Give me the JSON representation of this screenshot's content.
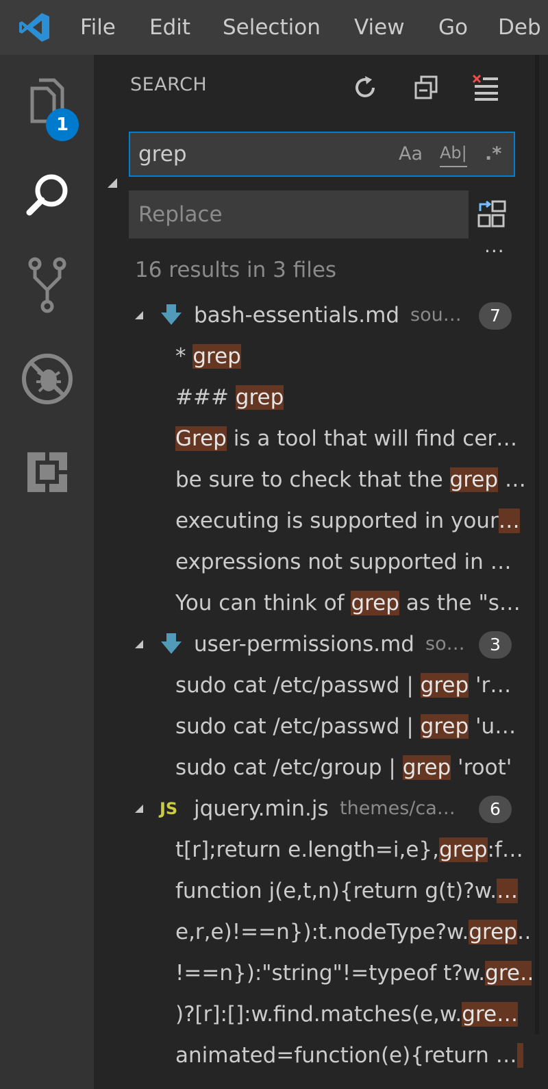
{
  "menu": [
    "File",
    "Edit",
    "Selection",
    "View",
    "Go",
    "Deb"
  ],
  "activity": {
    "explorer_badge": "1",
    "items": [
      "explorer-icon",
      "search-icon",
      "source-control-icon",
      "debug-icon",
      "extensions-icon"
    ]
  },
  "colors": {
    "accent": "#007acc",
    "match_highlight": "#653723",
    "clear_icon": "#f14c4c",
    "markdown_icon": "#519aba",
    "js_icon": "#cbcb41"
  },
  "search": {
    "title": "SEARCH",
    "query": "grep",
    "match_case_label": "Aa",
    "whole_word_label": "Ab|",
    "regex_label": ".*",
    "replace_placeholder": "Replace",
    "more": "...",
    "summary": "16 results in 3 files"
  },
  "results": [
    {
      "file": "bash-essentials.md",
      "path": "sou…",
      "icon": "markdown-icon",
      "count": "7",
      "matches": [
        {
          "before": "* ",
          "match": "grep",
          "after": ""
        },
        {
          "before": "### ",
          "match": "grep",
          "after": ""
        },
        {
          "before": "",
          "match": "Grep",
          "after": " is a tool that will find cer…"
        },
        {
          "before": "be sure to check that the ",
          "match": "grep",
          "after": " …"
        },
        {
          "before": "executing is supported in your",
          "match": "…",
          "after": ""
        },
        {
          "before": "expressions not supported in …",
          "match": "",
          "after": ""
        },
        {
          "before": "You can think of ",
          "match": "grep",
          "after": " as the \"s…"
        }
      ]
    },
    {
      "file": "user-permissions.md",
      "path": "so…",
      "icon": "markdown-icon",
      "count": "3",
      "matches": [
        {
          "before": "sudo cat /etc/passwd | ",
          "match": "grep",
          "after": " 'r…"
        },
        {
          "before": "sudo cat /etc/passwd | ",
          "match": "grep",
          "after": " 'u…"
        },
        {
          "before": "sudo cat /etc/group | ",
          "match": "grep",
          "after": " 'root'"
        }
      ]
    },
    {
      "file": "jquery.min.js",
      "path": "themes/ca…",
      "icon": "js-icon",
      "icon_text": "JS",
      "count": "6",
      "matches": [
        {
          "before": "t[r];return e.length=i,e},",
          "match": "grep",
          "after": ":f…"
        },
        {
          "before": "function j(e,t,n){return g(t)?w.",
          "match": "…",
          "after": ""
        },
        {
          "before": "e,r,e)!==n}):t.nodeType?w.",
          "match": "grep",
          "after": "…"
        },
        {
          "before": "!==n}):\"string\"!=typeof t?w.",
          "match": "gre…",
          "after": ""
        },
        {
          "before": ")?[r]:[]:w.find.matches(e,w.",
          "match": "gre…",
          "after": ""
        },
        {
          "before": "animated=function(e){return …",
          "match": " ",
          "after": ""
        }
      ]
    }
  ]
}
